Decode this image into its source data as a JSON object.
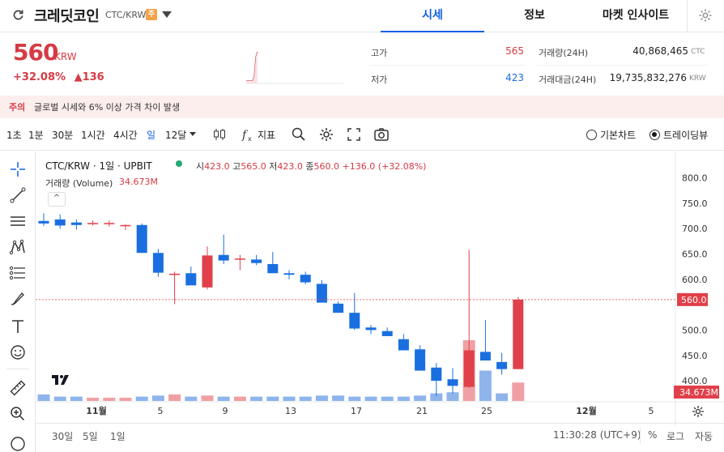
{
  "header": {
    "coin_name": "크레딧코인",
    "pair": "CTC/KRW",
    "warn_badge": "주",
    "tabs": [
      "시세",
      "정보",
      "마켓 인사이트"
    ],
    "active_tab": 0
  },
  "ticker": {
    "price": "560",
    "unit": "KRW",
    "change_pct": "+32.08%",
    "change_abs": "▲136",
    "high_label": "고가",
    "high": "565",
    "low_label": "저가",
    "low": "423",
    "volume_label": "거래량(24H)",
    "volume": "40,868,465",
    "volume_unit": "CTC",
    "amount_label": "거래대금(24H)",
    "amount": "19,735,832,276",
    "amount_unit": "KRW"
  },
  "notice": {
    "tag": "주의",
    "text": "글로벌 시세와 6% 이상 가격 차이 발생"
  },
  "toolbar": {
    "timeframes": [
      "1초",
      "1분",
      "30분",
      "1시간",
      "4시간",
      "일",
      "12달"
    ],
    "active_timeframe": 5,
    "indicator_label": "지표",
    "radio_basic": "기본차트",
    "radio_trading": "트레이딩뷰"
  },
  "chart_legend": {
    "title": "CTC/KRW · 1일 · UPBIT",
    "o_label": "시",
    "o": "423.0",
    "h_label": "고",
    "h": "565.0",
    "l_label": "저",
    "l": "423.0",
    "c_label": "종",
    "c": "560.0",
    "chg": "+136.0 (+32.08%)",
    "vol_label": "거래량 (Volume)",
    "vol_value": "34.673M",
    "collapse": "^"
  },
  "bottom": {
    "ranges": [
      "30일",
      "5일",
      "1일"
    ],
    "time": "11:30:28 (UTC+9)",
    "pct": "%",
    "log": "로그",
    "auto": "자동"
  },
  "colors": {
    "up": "#e0404a",
    "down": "#1a6fe0",
    "accent": "#1560e8",
    "vol_up": "#f0a0a4",
    "vol_down": "#8fb4ec"
  },
  "chart_data": {
    "type": "candlestick",
    "price_axis": {
      "ticks": [
        800,
        750,
        700,
        650,
        600,
        550,
        500,
        450,
        400
      ],
      "labels": [
        "800.0",
        "750.0",
        "700.0",
        "650.0",
        "600.0",
        "",
        "500.0",
        "450.0",
        "400.0"
      ],
      "range": [
        365,
        820
      ]
    },
    "last_price_label": "560.0",
    "volume_label": "34.673M",
    "x_labels": [
      "11월",
      "5",
      "9",
      "13",
      "17",
      "21",
      "25",
      "12월",
      "5"
    ],
    "candles": [
      {
        "d": "10/30",
        "o": 715,
        "h": 730,
        "l": 705,
        "c": 710
      },
      {
        "d": "10/31",
        "o": 718,
        "h": 728,
        "l": 700,
        "c": 706
      },
      {
        "d": "11/01",
        "o": 712,
        "h": 718,
        "l": 698,
        "c": 707
      },
      {
        "d": "11/02",
        "o": 711,
        "h": 716,
        "l": 706,
        "c": 711
      },
      {
        "d": "11/03",
        "o": 711,
        "h": 716,
        "l": 704,
        "c": 711
      },
      {
        "d": "11/04",
        "o": 707,
        "h": 708,
        "l": 697,
        "c": 707
      },
      {
        "d": "11/05",
        "o": 707,
        "h": 710,
        "l": 700,
        "c": 652
      },
      {
        "d": "11/06",
        "o": 652,
        "h": 660,
        "l": 605,
        "c": 613
      },
      {
        "d": "11/07",
        "o": 611,
        "h": 615,
        "l": 551,
        "c": 611
      },
      {
        "d": "11/08",
        "o": 612,
        "h": 625,
        "l": 595,
        "c": 588
      },
      {
        "d": "11/09",
        "o": 584,
        "h": 665,
        "l": 580,
        "c": 647
      },
      {
        "d": "11/10",
        "o": 648,
        "h": 688,
        "l": 630,
        "c": 637
      },
      {
        "d": "11/11",
        "o": 641,
        "h": 648,
        "l": 618,
        "c": 641
      },
      {
        "d": "11/12",
        "o": 639,
        "h": 648,
        "l": 628,
        "c": 632
      },
      {
        "d": "11/13",
        "o": 630,
        "h": 654,
        "l": 620,
        "c": 612
      },
      {
        "d": "11/14",
        "o": 612,
        "h": 618,
        "l": 600,
        "c": 609
      },
      {
        "d": "11/15",
        "o": 609,
        "h": 615,
        "l": 590,
        "c": 594
      },
      {
        "d": "11/16",
        "o": 591,
        "h": 598,
        "l": 575,
        "c": 554
      },
      {
        "d": "11/17",
        "o": 552,
        "h": 556,
        "l": 535,
        "c": 534
      },
      {
        "d": "11/18",
        "o": 534,
        "h": 573,
        "l": 500,
        "c": 503
      },
      {
        "d": "11/19",
        "o": 505,
        "h": 510,
        "l": 492,
        "c": 500
      },
      {
        "d": "11/20",
        "o": 498,
        "h": 505,
        "l": 490,
        "c": 488
      },
      {
        "d": "11/21",
        "o": 482,
        "h": 492,
        "l": 465,
        "c": 460
      },
      {
        "d": "11/22",
        "o": 462,
        "h": 470,
        "l": 420,
        "c": 420
      },
      {
        "d": "11/23",
        "o": 426,
        "h": 435,
        "l": 370,
        "c": 400
      },
      {
        "d": "11/24",
        "o": 403,
        "h": 425,
        "l": 375,
        "c": 390
      },
      {
        "d": "11/25",
        "o": 388,
        "h": 658,
        "l": 386,
        "c": 460
      },
      {
        "d": "11/26",
        "o": 457,
        "h": 520,
        "l": 442,
        "c": 440
      },
      {
        "d": "11/27",
        "o": 437,
        "h": 455,
        "l": 412,
        "c": 423
      },
      {
        "d": "11/28",
        "o": 423,
        "h": 565,
        "l": 423,
        "c": 560
      }
    ],
    "volumes": [
      3,
      2,
      2,
      1.5,
      1.5,
      1.5,
      2,
      2.5,
      3,
      2,
      2.5,
      2,
      2,
      2,
      2,
      2,
      2,
      2.5,
      2.5,
      2,
      2,
      2,
      2,
      2.5,
      3.5,
      4,
      28,
      14,
      3.5,
      8.5
    ]
  }
}
